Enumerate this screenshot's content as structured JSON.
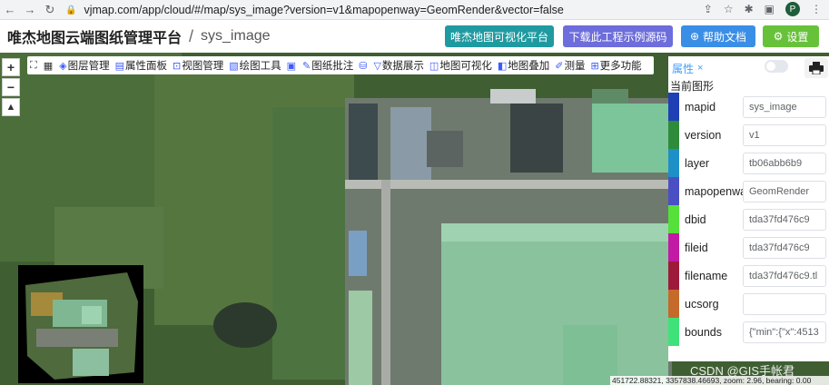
{
  "browser": {
    "url": "vjmap.com/app/cloud/#/map/sys_image?version=v1&mapopenway=GeomRender&vector=false",
    "profile_initial": "P"
  },
  "header": {
    "title": "唯杰地图云端图纸管理平台",
    "separator": "/",
    "subtitle": "sys_image",
    "buttons": {
      "viz": "唯杰地图可视化平台",
      "download": "下载此工程示例源码",
      "help": "帮助文档",
      "settings": "设置"
    }
  },
  "map_controls": {
    "zoom_in": "+",
    "zoom_out": "−"
  },
  "toolbar": {
    "items": [
      "图层管理",
      "属性面板",
      "视图管理",
      "绘图工具",
      "图纸批注",
      "数据展示",
      "地图可视化",
      "地图叠加",
      "测量",
      "更多功能"
    ]
  },
  "panel": {
    "tab_label": "属性",
    "close": "×",
    "heading": "当前图形",
    "rows": [
      {
        "key": "mapid",
        "value": "sys_image",
        "color": "#1f3fb5"
      },
      {
        "key": "version",
        "value": "v1",
        "color": "#2e8b3a"
      },
      {
        "key": "layer",
        "value": "tb06abb6b9",
        "color": "#1e90c8"
      },
      {
        "key": "mapopenway",
        "value": "GeomRender",
        "color": "#4b4fc4"
      },
      {
        "key": "dbid",
        "value": "tda37fd476c9",
        "color": "#55e03a"
      },
      {
        "key": "fileid",
        "value": "tda37fd476c9",
        "color": "#c21aa5"
      },
      {
        "key": "filename",
        "value": "tda37fd476c9.tl",
        "color": "#9e1a3a"
      },
      {
        "key": "ucsorg",
        "value": "",
        "color": "#c56a2a"
      },
      {
        "key": "bounds",
        "value": "{\"min\":{\"x\":4513",
        "color": "#3fe27a"
      }
    ]
  },
  "status": {
    "coords": "451722.88321, 3357838.46693, zoom: 2.96, bearing: 0.00"
  },
  "watermark": "CSDN @GIS手帐君"
}
